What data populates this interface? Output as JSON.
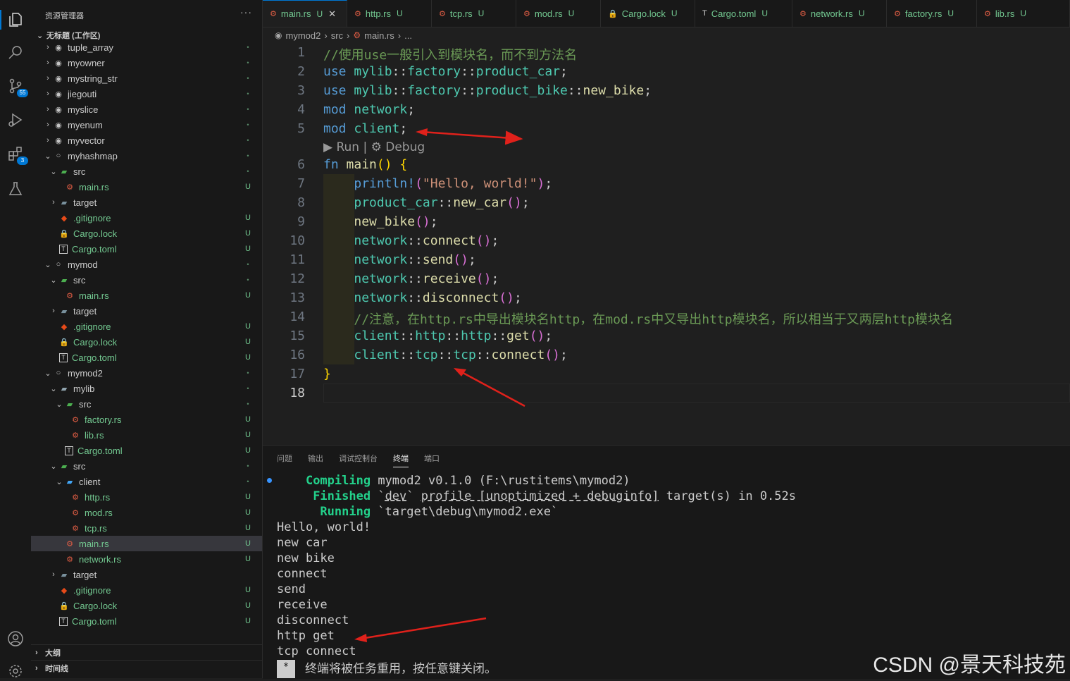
{
  "activity_bar": {
    "items": [
      {
        "name": "explorer-icon",
        "badge": ""
      },
      {
        "name": "search-icon",
        "badge": ""
      },
      {
        "name": "source-control-icon",
        "badge": "55"
      },
      {
        "name": "run-debug-icon",
        "badge": ""
      },
      {
        "name": "extensions-icon",
        "badge": "3"
      },
      {
        "name": "testing-icon",
        "badge": ""
      }
    ],
    "bottom": [
      {
        "name": "account-icon"
      },
      {
        "name": "settings-gear-icon"
      }
    ]
  },
  "sidebar": {
    "title": "资源管理器",
    "more": "···",
    "workspace": "无标题 (工作区)",
    "tree": [
      {
        "label": "tuple_array",
        "depth": 0,
        "type": "crate",
        "chev": "›",
        "status": "•"
      },
      {
        "label": "myowner",
        "depth": 0,
        "type": "crate",
        "chev": "›",
        "status": "•"
      },
      {
        "label": "mystring_str",
        "depth": 0,
        "type": "crate",
        "chev": "›",
        "status": "•"
      },
      {
        "label": "jiegouti",
        "depth": 0,
        "type": "crate",
        "chev": "›",
        "status": "•"
      },
      {
        "label": "myslice",
        "depth": 0,
        "type": "crate",
        "chev": "›",
        "status": "•"
      },
      {
        "label": "myenum",
        "depth": 0,
        "type": "crate",
        "chev": "›",
        "status": "•"
      },
      {
        "label": "myvector",
        "depth": 0,
        "type": "crate",
        "chev": "›",
        "status": "•"
      },
      {
        "label": "myhashmap",
        "depth": 0,
        "type": "crate-open",
        "chev": "⌄",
        "status": "•"
      },
      {
        "label": "src",
        "depth": 1,
        "type": "folder-src",
        "chev": "⌄",
        "status": "•"
      },
      {
        "label": "main.rs",
        "depth": 2,
        "type": "rust",
        "chev": "",
        "status": "U"
      },
      {
        "label": "target",
        "depth": 1,
        "type": "folder-target",
        "chev": "›",
        "status": ""
      },
      {
        "label": ".gitignore",
        "depth": 1,
        "type": "git",
        "chev": "",
        "status": "U"
      },
      {
        "label": "Cargo.lock",
        "depth": 1,
        "type": "lock",
        "chev": "",
        "status": "U"
      },
      {
        "label": "Cargo.toml",
        "depth": 1,
        "type": "toml",
        "chev": "",
        "status": "U"
      },
      {
        "label": "mymod",
        "depth": 0,
        "type": "crate-open",
        "chev": "⌄",
        "status": "•"
      },
      {
        "label": "src",
        "depth": 1,
        "type": "folder-src",
        "chev": "⌄",
        "status": "•"
      },
      {
        "label": "main.rs",
        "depth": 2,
        "type": "rust",
        "chev": "",
        "status": "U"
      },
      {
        "label": "target",
        "depth": 1,
        "type": "folder-target",
        "chev": "›",
        "status": ""
      },
      {
        "label": ".gitignore",
        "depth": 1,
        "type": "git",
        "chev": "",
        "status": "U"
      },
      {
        "label": "Cargo.lock",
        "depth": 1,
        "type": "lock",
        "chev": "",
        "status": "U"
      },
      {
        "label": "Cargo.toml",
        "depth": 1,
        "type": "toml",
        "chev": "",
        "status": "U"
      },
      {
        "label": "mymod2",
        "depth": 0,
        "type": "crate-open",
        "chev": "⌄",
        "status": "•"
      },
      {
        "label": "mylib",
        "depth": 1,
        "type": "folder",
        "chev": "⌄",
        "status": "•"
      },
      {
        "label": "src",
        "depth": 2,
        "type": "folder-src",
        "chev": "⌄",
        "status": "•"
      },
      {
        "label": "factory.rs",
        "depth": 3,
        "type": "rust",
        "chev": "",
        "status": "U"
      },
      {
        "label": "lib.rs",
        "depth": 3,
        "type": "rust",
        "chev": "",
        "status": "U"
      },
      {
        "label": "Cargo.toml",
        "depth": 2,
        "type": "toml",
        "chev": "",
        "status": "U"
      },
      {
        "label": "src",
        "depth": 1,
        "type": "folder-src",
        "chev": "⌄",
        "status": "•"
      },
      {
        "label": "client",
        "depth": 2,
        "type": "folder-client",
        "chev": "⌄",
        "status": "•"
      },
      {
        "label": "http.rs",
        "depth": 3,
        "type": "rust",
        "chev": "",
        "status": "U"
      },
      {
        "label": "mod.rs",
        "depth": 3,
        "type": "rust",
        "chev": "",
        "status": "U"
      },
      {
        "label": "tcp.rs",
        "depth": 3,
        "type": "rust",
        "chev": "",
        "status": "U"
      },
      {
        "label": "main.rs",
        "depth": 2,
        "type": "rust",
        "chev": "",
        "status": "U",
        "selected": true
      },
      {
        "label": "network.rs",
        "depth": 2,
        "type": "rust",
        "chev": "",
        "status": "U"
      },
      {
        "label": "target",
        "depth": 1,
        "type": "folder-target",
        "chev": "›",
        "status": ""
      },
      {
        "label": ".gitignore",
        "depth": 1,
        "type": "git",
        "chev": "",
        "status": "U"
      },
      {
        "label": "Cargo.lock",
        "depth": 1,
        "type": "lock",
        "chev": "",
        "status": "U"
      },
      {
        "label": "Cargo.toml",
        "depth": 1,
        "type": "toml",
        "chev": "",
        "status": "U"
      }
    ],
    "outline_label": "大纲",
    "timeline_label": "时间线"
  },
  "tabs": [
    {
      "label": "main.rs",
      "icon": "rust",
      "status": "U",
      "active": true,
      "close": "✕"
    },
    {
      "label": "http.rs",
      "icon": "rust",
      "status": "U"
    },
    {
      "label": "tcp.rs",
      "icon": "rust",
      "status": "U"
    },
    {
      "label": "mod.rs",
      "icon": "rust",
      "status": "U"
    },
    {
      "label": "Cargo.lock",
      "icon": "lock",
      "status": "U"
    },
    {
      "label": "Cargo.toml",
      "icon": "toml",
      "status": "U"
    },
    {
      "label": "network.rs",
      "icon": "rust",
      "status": "U"
    },
    {
      "label": "factory.rs",
      "icon": "rust",
      "status": "U"
    },
    {
      "label": "lib.rs",
      "icon": "rust",
      "status": "U"
    }
  ],
  "breadcrumb": [
    "mymod2",
    "src",
    "main.rs",
    "..."
  ],
  "editor": {
    "codelens": "▶ Run | ⚙ Debug",
    "current_line": 18,
    "lines": [
      {
        "n": "1",
        "tokens": [
          [
            "cm",
            "//使用use一般引入到模块名，而不到方法名"
          ]
        ]
      },
      {
        "n": "2",
        "tokens": [
          [
            "kw",
            "use"
          ],
          [
            "pl",
            " "
          ],
          [
            "ns",
            "mylib"
          ],
          [
            "pl",
            "::"
          ],
          [
            "ns",
            "factory"
          ],
          [
            "pl",
            "::"
          ],
          [
            "ns",
            "product_car"
          ],
          [
            "pl",
            ";"
          ]
        ]
      },
      {
        "n": "3",
        "tokens": [
          [
            "kw",
            "use"
          ],
          [
            "pl",
            " "
          ],
          [
            "ns",
            "mylib"
          ],
          [
            "pl",
            "::"
          ],
          [
            "ns",
            "factory"
          ],
          [
            "pl",
            "::"
          ],
          [
            "ns",
            "product_bike"
          ],
          [
            "pl",
            "::"
          ],
          [
            "fnn",
            "new_bike"
          ],
          [
            "pl",
            ";"
          ]
        ]
      },
      {
        "n": "4",
        "tokens": [
          [
            "kw",
            "mod"
          ],
          [
            "pl",
            " "
          ],
          [
            "ns",
            "network"
          ],
          [
            "pl",
            ";"
          ]
        ]
      },
      {
        "n": "5",
        "tokens": [
          [
            "kw",
            "mod"
          ],
          [
            "pl",
            " "
          ],
          [
            "ns",
            "client"
          ],
          [
            "pl",
            ";"
          ]
        ]
      },
      {
        "n": "6",
        "tokens": [
          [
            "kw",
            "fn"
          ],
          [
            "pl",
            " "
          ],
          [
            "fnn",
            "main"
          ],
          [
            "br1",
            "()"
          ],
          [
            "pl",
            " "
          ],
          [
            "br1",
            "{"
          ]
        ]
      },
      {
        "n": "7",
        "tokens": [
          [
            "pl",
            "    "
          ],
          [
            "mac",
            "println!"
          ],
          [
            "br2",
            "("
          ],
          [
            "str",
            "\"Hello, world!\""
          ],
          [
            "br2",
            ")"
          ],
          [
            "pl",
            ";"
          ]
        ]
      },
      {
        "n": "8",
        "tokens": [
          [
            "pl",
            "    "
          ],
          [
            "ns",
            "product_car"
          ],
          [
            "pl",
            "::"
          ],
          [
            "fnn",
            "new_car"
          ],
          [
            "br2",
            "()"
          ],
          [
            "pl",
            ";"
          ]
        ]
      },
      {
        "n": "9",
        "tokens": [
          [
            "pl",
            "    "
          ],
          [
            "fnn",
            "new_bike"
          ],
          [
            "br2",
            "()"
          ],
          [
            "pl",
            ";"
          ]
        ]
      },
      {
        "n": "10",
        "tokens": [
          [
            "pl",
            "    "
          ],
          [
            "ns",
            "network"
          ],
          [
            "pl",
            "::"
          ],
          [
            "fnn",
            "connect"
          ],
          [
            "br2",
            "()"
          ],
          [
            "pl",
            ";"
          ]
        ]
      },
      {
        "n": "11",
        "tokens": [
          [
            "pl",
            "    "
          ],
          [
            "ns",
            "network"
          ],
          [
            "pl",
            "::"
          ],
          [
            "fnn",
            "send"
          ],
          [
            "br2",
            "()"
          ],
          [
            "pl",
            ";"
          ]
        ]
      },
      {
        "n": "12",
        "tokens": [
          [
            "pl",
            "    "
          ],
          [
            "ns",
            "network"
          ],
          [
            "pl",
            "::"
          ],
          [
            "fnn",
            "receive"
          ],
          [
            "br2",
            "()"
          ],
          [
            "pl",
            ";"
          ]
        ]
      },
      {
        "n": "13",
        "tokens": [
          [
            "pl",
            "    "
          ],
          [
            "ns",
            "network"
          ],
          [
            "pl",
            "::"
          ],
          [
            "fnn",
            "disconnect"
          ],
          [
            "br2",
            "()"
          ],
          [
            "pl",
            ";"
          ]
        ]
      },
      {
        "n": "14",
        "tokens": [
          [
            "pl",
            "    "
          ],
          [
            "cm",
            "//注意，在http.rs中导出模块名http，在mod.rs中又导出http模块名，所以相当于又两层http模块名"
          ]
        ]
      },
      {
        "n": "15",
        "tokens": [
          [
            "pl",
            "    "
          ],
          [
            "ns",
            "client"
          ],
          [
            "pl",
            "::"
          ],
          [
            "ns",
            "http"
          ],
          [
            "pl",
            "::"
          ],
          [
            "ns",
            "http"
          ],
          [
            "pl",
            "::"
          ],
          [
            "fnn",
            "get"
          ],
          [
            "br2",
            "()"
          ],
          [
            "pl",
            ";"
          ]
        ]
      },
      {
        "n": "16",
        "tokens": [
          [
            "pl",
            "    "
          ],
          [
            "ns",
            "client"
          ],
          [
            "pl",
            "::"
          ],
          [
            "ns",
            "tcp"
          ],
          [
            "pl",
            "::"
          ],
          [
            "ns",
            "tcp"
          ],
          [
            "pl",
            "::"
          ],
          [
            "fnn",
            "connect"
          ],
          [
            "br2",
            "()"
          ],
          [
            "pl",
            ";"
          ]
        ]
      },
      {
        "n": "17",
        "tokens": [
          [
            "br1",
            "}"
          ]
        ]
      },
      {
        "n": "18",
        "tokens": []
      }
    ]
  },
  "panel": {
    "tabs": [
      "问题",
      "输出",
      "调试控制台",
      "终端",
      "端口"
    ],
    "active_tab": "终端",
    "terminal": {
      "compiling_label": "Compiling",
      "compiling_text": " mymod2 v0.1.0 (F:\\rustitems\\mymod2)",
      "finished_label": "Finished",
      "finished_pre": " `",
      "finished_profile": "dev",
      "finished_mid": "` ",
      "finished_profile2": "profile [unoptimized + debuginfo]",
      "finished_post": " target(s) in 0.52s",
      "running_label": "Running",
      "running_text": " `target\\debug\\mymod2.exe`",
      "output": [
        "Hello, world!",
        "new car",
        "new bike",
        "connect",
        "send",
        "receive",
        "disconnect",
        "http get",
        "tcp connect"
      ],
      "cursor": "*",
      "reuse_msg": "终端将被任务重用，按任意键关闭。"
    }
  },
  "watermark": "CSDN @景天科技苑",
  "colors": {
    "accent": "#0078d4",
    "untracked": "#73c991",
    "annotation_arrow": "#e0211b"
  }
}
